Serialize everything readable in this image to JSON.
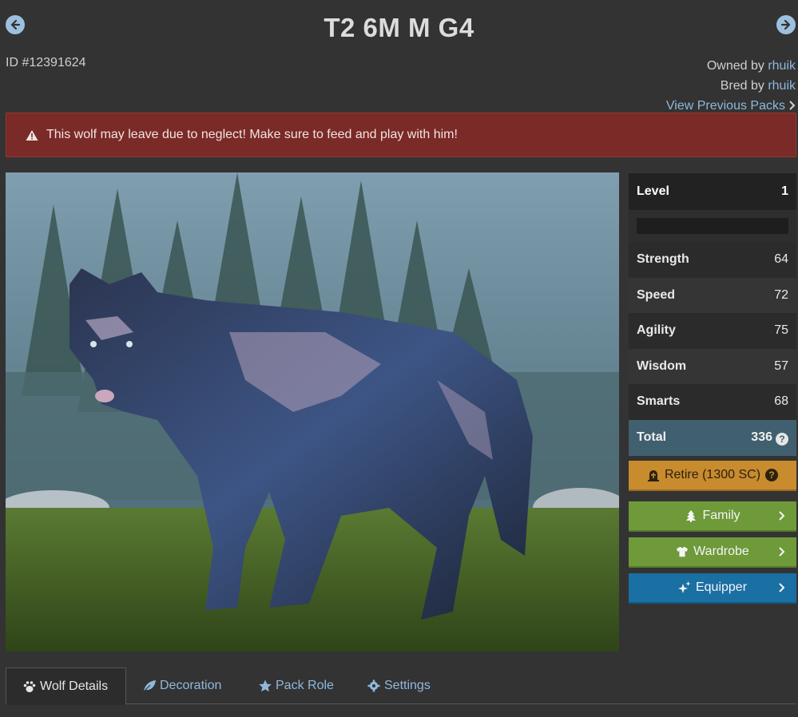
{
  "header": {
    "title": "T2 6M M G4",
    "id_text": "ID #12391624"
  },
  "ownership": {
    "owned_prefix": "Owned by",
    "owner": "rhuik",
    "bred_prefix": "Bred by",
    "breeder": "rhuik",
    "previous_packs": "View Previous Packs"
  },
  "alert": {
    "message": "This wolf may leave due to neglect! Make sure to feed and play with him!"
  },
  "stats": {
    "level_label": "Level",
    "level_value": "1",
    "xp_progress": 0,
    "rows": [
      {
        "label": "Strength",
        "value": "64"
      },
      {
        "label": "Speed",
        "value": "72"
      },
      {
        "label": "Agility",
        "value": "75"
      },
      {
        "label": "Wisdom",
        "value": "57"
      },
      {
        "label": "Smarts",
        "value": "68"
      }
    ],
    "total_label": "Total",
    "total_value": "336"
  },
  "actions": {
    "retire": "Retire (1300 SC)",
    "family": "Family",
    "wardrobe": "Wardrobe",
    "equipper": "Equipper"
  },
  "tabs": [
    {
      "label": "Wolf Details",
      "icon": "paw-icon",
      "active": true
    },
    {
      "label": "Decoration",
      "icon": "leaf-icon",
      "active": false
    },
    {
      "label": "Pack Role",
      "icon": "star-icon",
      "active": false
    },
    {
      "label": "Settings",
      "icon": "gear-icon",
      "active": false
    }
  ],
  "colors": {
    "background": "#333333",
    "alert": "#7a2a27",
    "retire": "#c88b2e",
    "green_button": "#6e9a3a",
    "blue_button": "#1a6fa3",
    "total_row": "#40606f",
    "link": "#8fb8dd"
  }
}
